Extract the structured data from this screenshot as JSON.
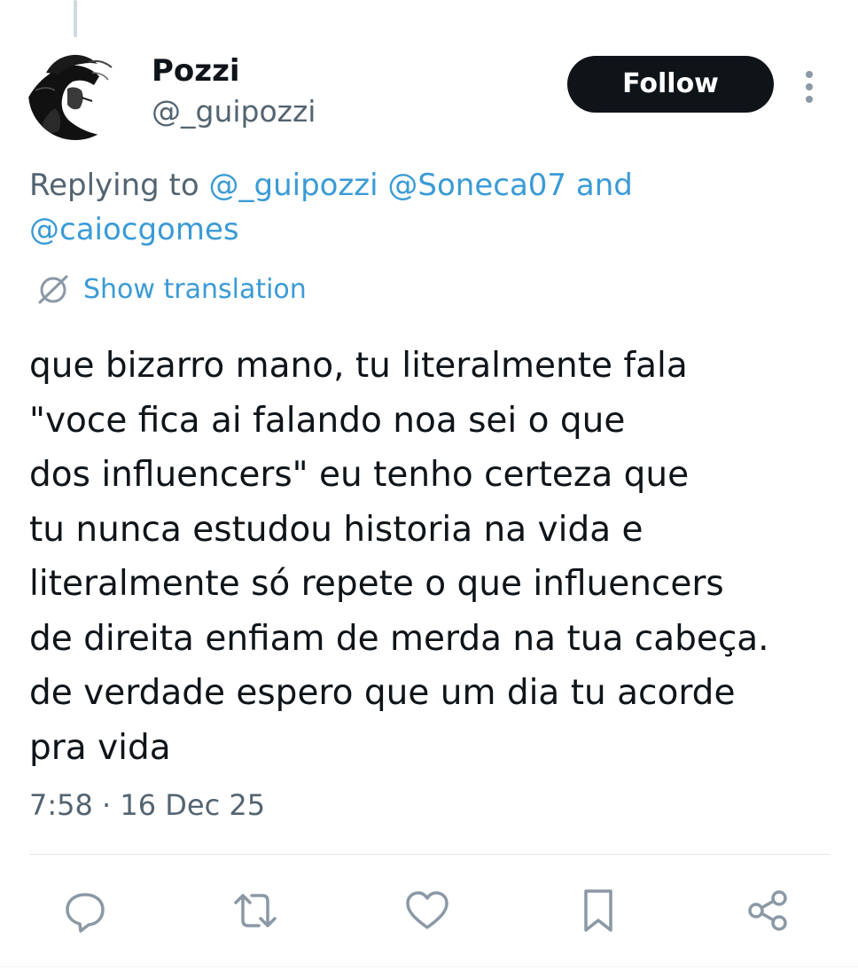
{
  "author": {
    "display_name": "Pozzi",
    "handle": "@_guipozzi",
    "avatar_icon": "avatar-sketch"
  },
  "header": {
    "follow_label": "Follow",
    "more_icon": "more-vertical-icon"
  },
  "reply_context": {
    "prefix": "Replying to",
    "mention_1": "@_guipozzi",
    "mention_2": "@Soneca07",
    "mention_3": "@caiocgomes",
    "conjunction": "and"
  },
  "translation": {
    "label": "Show translation",
    "icon": "globe-icon"
  },
  "tweet": {
    "text": "que bizarro mano, tu literalmente fala\n\"voce fica ai falando noa sei o que\ndos influencers\" eu tenho certeza que\ntu nunca estudou historia na vida e\nliteralmente só repete o que influencers\nde direita enfiam de merda na tua cabeça.\nde verdade espero que um dia tu acorde\npra vida",
    "timestamp": "7:58 · 16 Dec 25"
  },
  "actions": {
    "reply_icon": "reply-icon",
    "retweet_icon": "retweet-icon",
    "like_icon": "like-icon",
    "bookmark_icon": "bookmark-icon",
    "share_icon": "share-icon"
  },
  "colors": {
    "text": "#0f1419",
    "secondary": "#536471",
    "link": "#3a9bd6",
    "button": "#0f1419",
    "icon": "#8b98a5"
  }
}
